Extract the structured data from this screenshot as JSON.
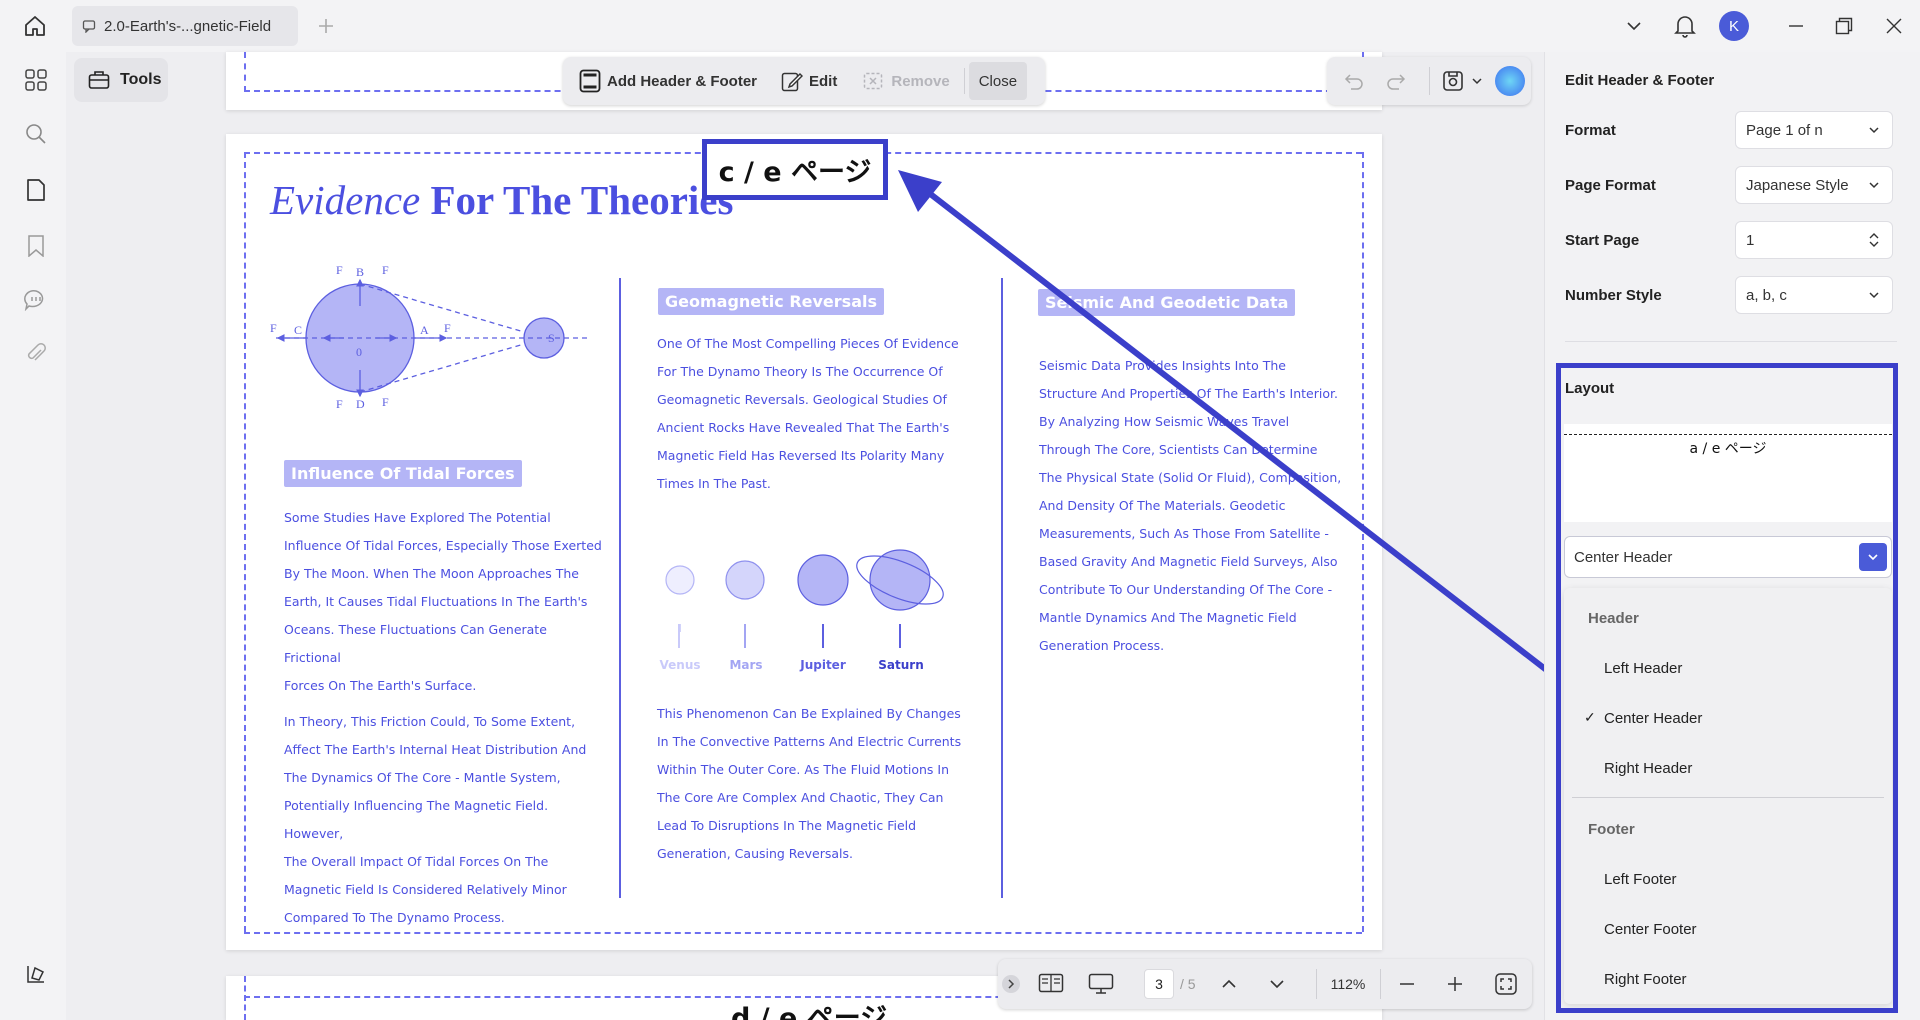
{
  "tab": {
    "title": "2.0-Earth's-...gnetic-Field"
  },
  "user": {
    "initial": "K"
  },
  "sidebar": {
    "tools_label": "Tools"
  },
  "toolbar": {
    "add_label": "Add Header & Footer",
    "edit_label": "Edit",
    "remove_label": "Remove",
    "close_label": "Close"
  },
  "page": {
    "header_text": "c / e ページ",
    "next_header_text": "d / e ページ",
    "title_italic": "Evidence",
    "title_rest": " For The Theories",
    "sections": [
      {
        "heading": "Influence Of Tidal Forces",
        "paragraphs": [
          "Some Studies Have Explored The Potential\nInfluence Of Tidal Forces, Especially Those Exerted\nBy The Moon. When The Moon Approaches The\nEarth, It Causes Tidal Fluctuations In The Earth's\nOceans. These Fluctuations Can Generate Frictional\nForces On The Earth's Surface.",
          " In Theory, This Friction Could, To Some Extent,\nAffect The Earth's Internal Heat Distribution And\nThe Dynamics Of The Core - Mantle System,\nPotentially Influencing The Magnetic Field. However,\nThe Overall Impact Of Tidal Forces On The\nMagnetic Field Is Considered Relatively Minor\nCompared To The Dynamo Process."
        ]
      },
      {
        "heading": "Geomagnetic Reversals",
        "paragraphs": [
          "One Of The Most Compelling Pieces Of Evidence\nFor The Dynamo Theory Is The Occurrence Of\nGeomagnetic Reversals. Geological Studies Of\nAncient Rocks Have Revealed That The Earth's\nMagnetic Field Has Reversed Its Polarity Many\nTimes In The Past.",
          "This Phenomenon Can Be Explained By Changes\nIn The Convective Patterns And Electric Currents\nWithin The Outer Core. As The Fluid Motions In\nThe Core Are Complex And Chaotic, They Can\nLead To Disruptions In The Magnetic Field\nGeneration, Causing Reversals."
        ]
      },
      {
        "heading": "Seismic And Geodetic Data",
        "paragraphs": [
          "Seismic Data Provides Insights Into The\nStructure And Properties Of The Earth's Interior.\nBy Analyzing How Seismic Waves Travel\nThrough The Core, Scientists Can Determine\nThe Physical State (Solid Or Fluid), Composition,\nAnd Density Of The Materials. Geodetic\nMeasurements, Such As Those From Satellite -\nBased Gravity And Magnetic Field Surveys, Also\nContribute To Our Understanding Of The Core -\nMantle Dynamics And The Magnetic Field\nGeneration Process."
        ]
      }
    ],
    "planets": [
      "Venus",
      "Mars",
      "Jupiter",
      "Saturn"
    ],
    "diagram_labels": {
      "b": "B",
      "d": "D",
      "c": "C",
      "a": "A",
      "zero": "0",
      "s": "S",
      "f": "F"
    }
  },
  "bottombar": {
    "page_current": "3",
    "page_total": "/ 5",
    "zoom": "112%"
  },
  "panel": {
    "title": "Edit Header & Footer",
    "fields": [
      {
        "label": "Format",
        "value": "Page 1 of n"
      },
      {
        "label": "Page Format",
        "value": "Japanese Style"
      },
      {
        "label": "Start Page",
        "value": "1"
      },
      {
        "label": "Number Style",
        "value": "a, b, c"
      }
    ],
    "layout_label": "Layout",
    "preview_text": "a / e ページ",
    "position_value": "Center Header",
    "menu": {
      "header_group": "Header",
      "header_items": [
        "Left Header",
        "Center Header",
        "Right Header"
      ],
      "footer_group": "Footer",
      "footer_items": [
        "Left Footer",
        "Center Footer",
        "Right Footer"
      ],
      "checked": "Center Header"
    }
  },
  "colors": {
    "accent": "#4a5bd8",
    "page_text": "#4b4fe0",
    "annotation": "#3b3fca"
  }
}
